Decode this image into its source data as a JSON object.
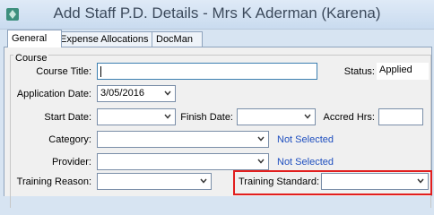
{
  "window": {
    "title": "Add Staff P.D. Details - Mrs K Aderman (Karena)"
  },
  "tabs": [
    "General",
    "Expense Allocations",
    "DocMan"
  ],
  "group": {
    "label": "Course"
  },
  "fields": {
    "course_title": {
      "label": "Course Title:",
      "value": ""
    },
    "status": {
      "label": "Status:",
      "value": "Applied"
    },
    "application_date": {
      "label": "Application Date:",
      "value": "3/05/2016"
    },
    "start_date": {
      "label": "Start Date:",
      "value": ""
    },
    "finish_date": {
      "label": "Finish Date:",
      "value": ""
    },
    "accred_hrs": {
      "label": "Accred Hrs:",
      "value": ""
    },
    "category": {
      "label": "Category:",
      "value": "",
      "status_text": "Not Selected"
    },
    "provider": {
      "label": "Provider:",
      "value": "",
      "status_text": "Not Selected"
    },
    "training_reason": {
      "label": "Training Reason:",
      "value": ""
    },
    "training_standard": {
      "label": "Training Standard:",
      "value": ""
    }
  },
  "colors": {
    "link": "#1f4fbf",
    "highlight": "#e21e1e"
  }
}
